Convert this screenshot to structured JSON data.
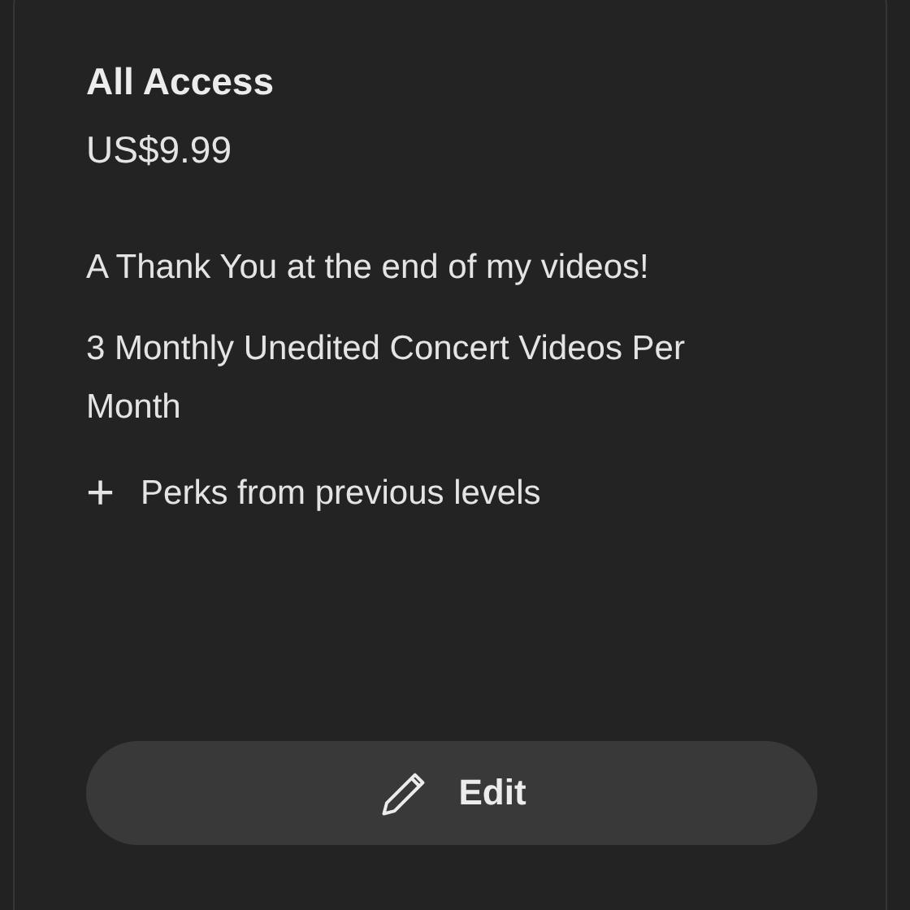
{
  "tier": {
    "title": "All Access",
    "price": "US$9.99"
  },
  "benefits": [
    "A Thank You at the end of my videos!",
    "3 Monthly Unedited Concert Videos Per Month"
  ],
  "perks": {
    "icon": "+",
    "label": "Perks from previous levels"
  },
  "edit_button": {
    "label": "Edit"
  }
}
